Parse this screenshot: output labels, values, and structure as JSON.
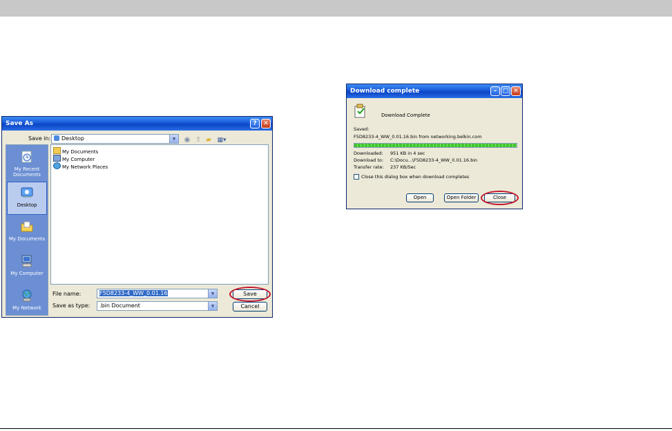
{
  "save_as": {
    "title": "Save As",
    "save_in_label": "Save in:",
    "save_in_value": "Desktop",
    "places": [
      {
        "label": "My Recent Documents",
        "icon": "recent-documents-icon"
      },
      {
        "label": "Desktop",
        "icon": "desktop-icon"
      },
      {
        "label": "My Documents",
        "icon": "my-documents-icon"
      },
      {
        "label": "My Computer",
        "icon": "my-computer-icon"
      },
      {
        "label": "My Network",
        "icon": "my-network-icon"
      }
    ],
    "files": [
      "My Documents",
      "My Computer",
      "My Network Places"
    ],
    "file_name_label": "File name:",
    "file_name_value": "F5D8233-4_WW_0.01.16",
    "save_type_label": "Save as type:",
    "save_type_value": ".bin Document",
    "save_button": "Save",
    "cancel_button": "Cancel"
  },
  "download": {
    "title": "Download complete",
    "heading": "Download Complete",
    "saved_label": "Saved:",
    "saved_value": "F5D8233-4_WW_0.01.16.bin from networking.belkin.com",
    "downloaded_label": "Downloaded:",
    "downloaded_value": "951 KB in 4 sec",
    "download_to_label": "Download to:",
    "download_to_value": "C:\\Docu...\\F5D8233-4_WW_0.01.16.bin",
    "transfer_label": "Transfer rate:",
    "transfer_value": "237 KB/Sec",
    "checkbox_label": "Close this dialog box when download completes",
    "progress": 1.0,
    "open_button": "Open",
    "open_folder_button": "Open Folder",
    "close_button": "Close"
  },
  "colors": {
    "highlight_ring": "#c5162c",
    "title_blue": "#0a45c5"
  }
}
